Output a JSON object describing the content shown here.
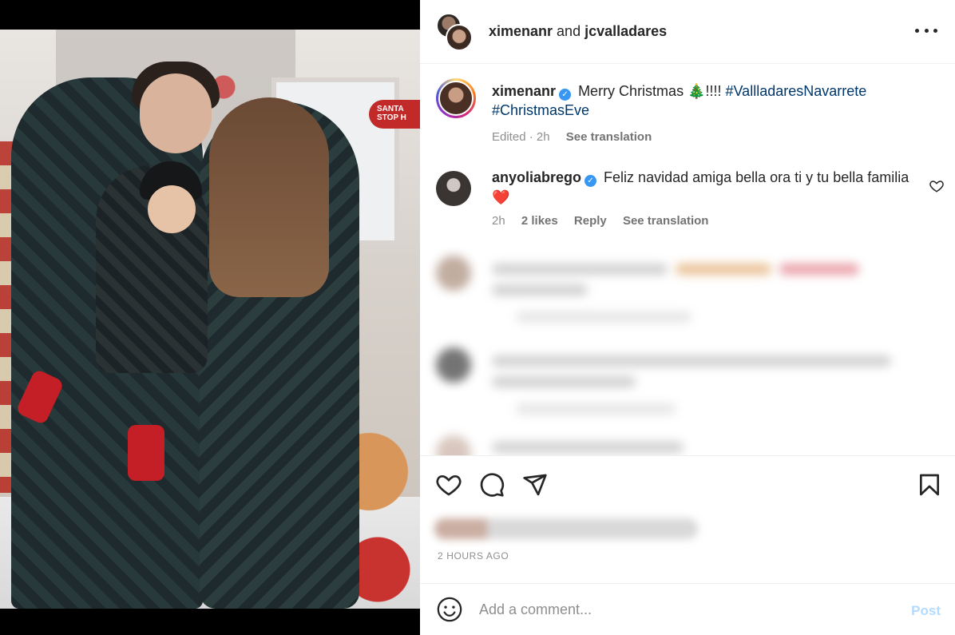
{
  "post": {
    "header": {
      "author1": "ximenanr",
      "joiner": " and ",
      "author2": "jcvalladares"
    },
    "photo": {
      "sign_text": "SANTA STOP H"
    },
    "caption": {
      "username": "ximenanr",
      "text": "Merry Christmas 🎄!!!!",
      "hashtag1": "#VallladaresNavarrete",
      "hashtag2": "#ChristmasEve",
      "edited": "Edited · 2h",
      "see_translation": "See translation"
    },
    "comment": {
      "username": "anyoliabrego",
      "text": "Feliz navidad amiga bella ora ti y tu bella familia",
      "emoji": "❤️",
      "time": "2h",
      "likes": "2 likes",
      "reply": "Reply",
      "see_translation": "See translation"
    },
    "timestamp": "2 HOURS AGO",
    "add_comment": {
      "placeholder": "Add a comment...",
      "post_label": "Post"
    }
  },
  "colors": {
    "link_blue": "#00376b",
    "verified": "#3897f0",
    "post_disabled": "#b3dbff",
    "muted": "#8e8e8e"
  }
}
